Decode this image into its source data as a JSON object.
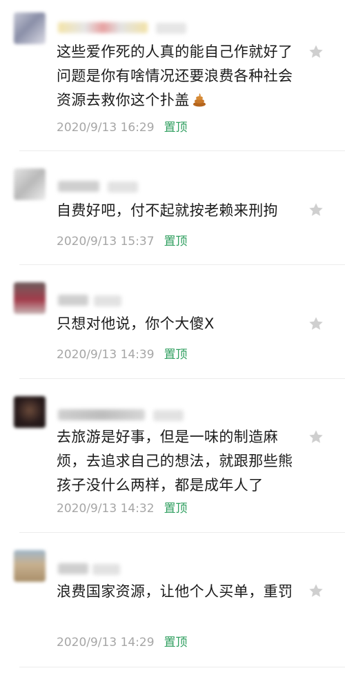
{
  "comments": [
    {
      "text_html": "",
      "text": "这些爱作死的人真的能自己作就好了 问题是你有啥情况还要浪费各种社会资源去救你这个扑盖",
      "emoji": "poop-emoji",
      "date": "2020/9/13 16:29",
      "pin_label": "置顶"
    },
    {
      "text": "自费好吧，付不起就按老赖来刑拘",
      "date": "2020/9/13 15:37",
      "pin_label": "置顶"
    },
    {
      "text": "只想对他说，你个大傻X",
      "date": "2020/9/13 14:39",
      "pin_label": "置顶"
    },
    {
      "text": "去旅游是好事，但是一味的制造麻烦，去追求自己的想法，就跟那些熊孩子没什么两样，都是成年人了",
      "date": "2020/9/13 14:32",
      "pin_label": "置顶"
    },
    {
      "text": "浪费国家资源，让他个人买单，重罚",
      "date": "2020/9/13 14:29",
      "pin_label": "置顶"
    }
  ],
  "icons": {
    "favorite": "star-icon",
    "colors": {
      "pin": "#2e9e5e",
      "meta": "#a6a6a6",
      "star": "#cfcfcf"
    }
  }
}
